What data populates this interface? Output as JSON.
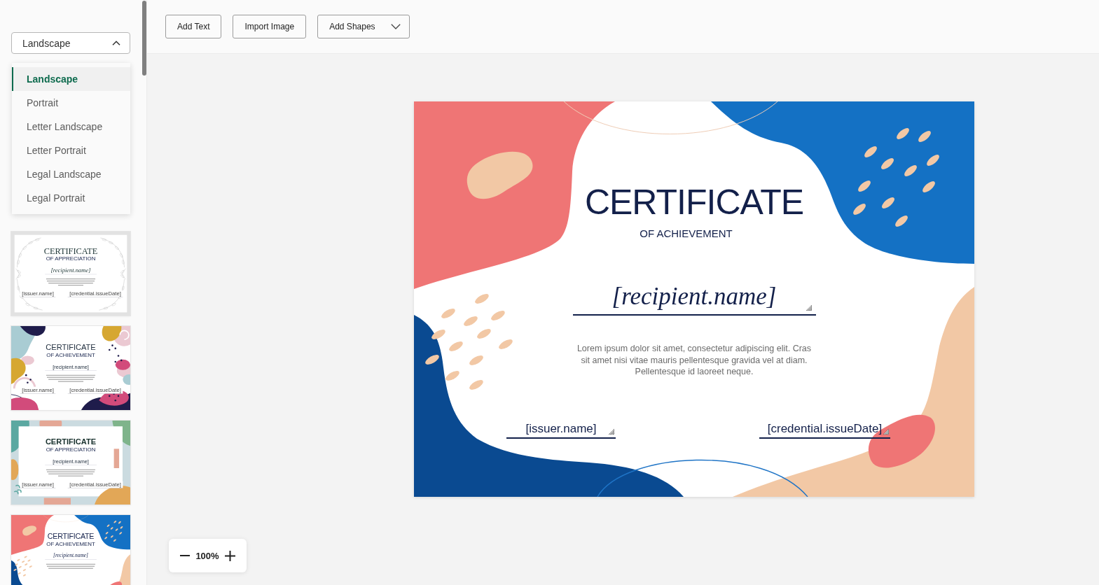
{
  "sidebar": {
    "layout_select": {
      "value": "Landscape",
      "expanded": true
    },
    "layout_options": [
      {
        "label": "Landscape",
        "selected": true
      },
      {
        "label": "Portrait",
        "selected": false
      },
      {
        "label": "Letter Landscape",
        "selected": false
      },
      {
        "label": "Letter Portrait",
        "selected": false
      },
      {
        "label": "Legal Landscape",
        "selected": false
      },
      {
        "label": "Legal Portrait",
        "selected": false
      }
    ],
    "templates": [
      {
        "kind": "floral",
        "title": "CERTIFICATE",
        "subtitle": "OF APPRECIATION",
        "recipient": "[recipient.name]",
        "issuer": "[issuer.name]",
        "date": "[credential.issueDate]"
      },
      {
        "kind": "memphis",
        "title": "CERTIFICATE",
        "subtitle": "OF ACHIEVEMENT",
        "recipient": "[recipient.name]",
        "issuer": "[issuer.name]",
        "date": "[credential.issueDate]"
      },
      {
        "kind": "pastel",
        "title": "CERTIFICATE",
        "subtitle": "OF APPRECIATION",
        "recipient": "[recipient.name]",
        "issuer": "[issuer.name]",
        "date": "[credential.issueDate]"
      },
      {
        "kind": "waves",
        "title": "CERTIFICATE",
        "subtitle": "OF ACHIEVEMENT",
        "recipient": "[recipient.name]"
      }
    ]
  },
  "toolbar": {
    "buttons": [
      {
        "kind": "plain",
        "label": "Add Text"
      },
      {
        "kind": "plain",
        "label": "Import Image"
      },
      {
        "kind": "dropdown",
        "label": "Add Shapes"
      }
    ]
  },
  "certificate": {
    "kind": "waves",
    "title": "CERTIFICATE",
    "subtitle": "OF ACHIEVEMENT",
    "recipient": "[recipient.name]",
    "body": "Lorem ipsum dolor sit amet, consectetur adipiscing elit. Cras sit amet nisi vitae mauris pellentesque gravida vel at diam. Pellentesque id laoreet neque.",
    "issuer": "[issuer.name]",
    "date": "[credential.issueDate]"
  },
  "zoom_control": {
    "level_text": "100%"
  }
}
